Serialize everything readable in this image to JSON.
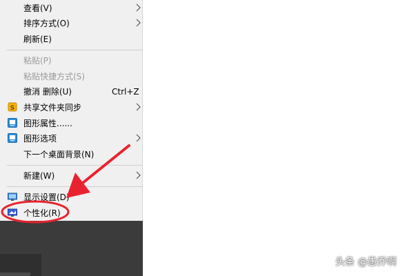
{
  "menu": {
    "items": [
      {
        "label": "查看(V)",
        "submenu": true
      },
      {
        "label": "排序方式(O)",
        "submenu": true
      },
      {
        "label": "刷新(E)"
      },
      {
        "label": "粘贴(P)",
        "disabled": true
      },
      {
        "label": "粘贴快捷方式(S)",
        "disabled": true
      },
      {
        "label": "撤消 删除(U)",
        "shortcut": "Ctrl+Z"
      },
      {
        "label": "共享文件夹同步",
        "icon": "sync-folder-icon",
        "submenu": true
      },
      {
        "label": "图形属性......",
        "icon": "graphics-properties-icon"
      },
      {
        "label": "图形选项",
        "icon": "graphics-options-icon",
        "submenu": true
      },
      {
        "label": "下一个桌面背景(N)"
      },
      {
        "label": "新建(W)",
        "submenu": true
      },
      {
        "label": "显示设置(D)",
        "icon": "display-settings-icon"
      },
      {
        "label": "个性化(R)",
        "icon": "personalize-icon"
      }
    ]
  },
  "watermark": "头条 @愚乔啊",
  "colors": {
    "menu_bg": "#f0f0f0",
    "annotation_red": "#e8232f",
    "disabled_text": "#9a9a9a",
    "dark_taskbar": "#3b3b3b"
  }
}
